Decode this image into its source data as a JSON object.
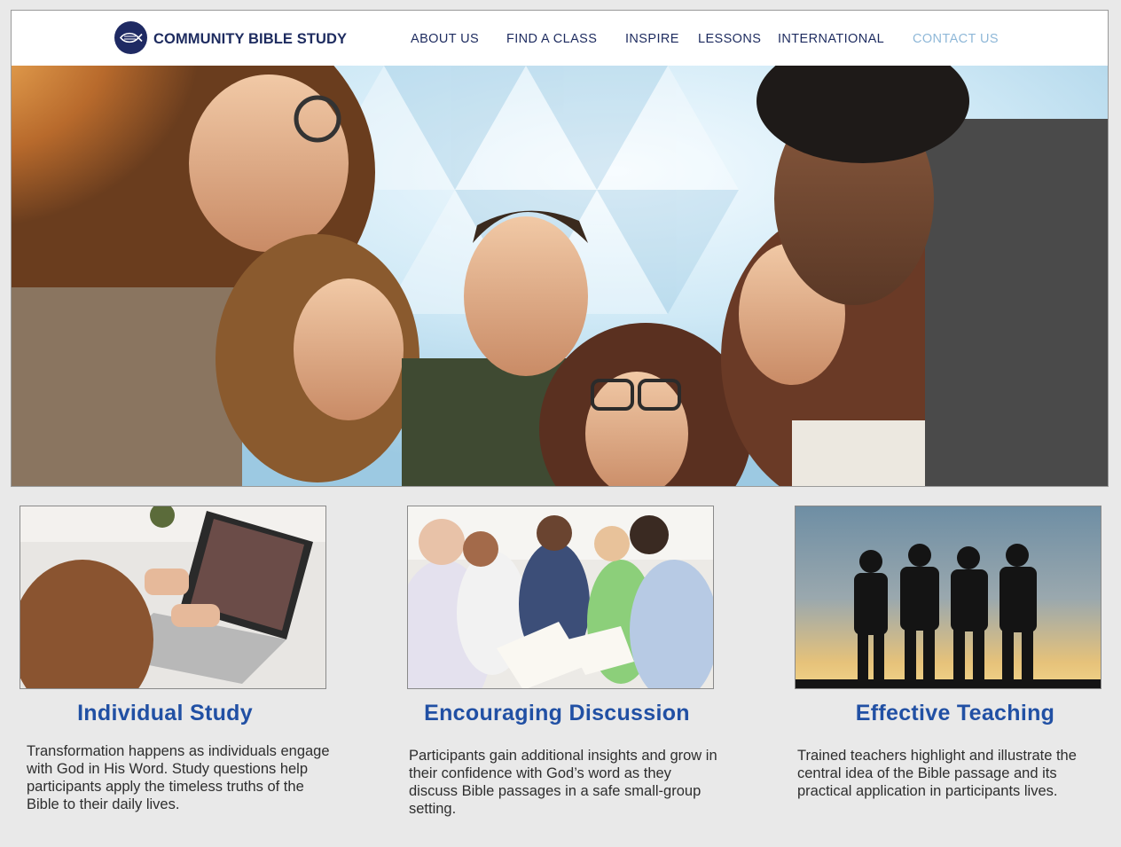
{
  "brand": {
    "name": "COMMUNITY BIBLE STUDY",
    "logo_icon": "fish-icon"
  },
  "nav": {
    "items": [
      {
        "label": "ABOUT US"
      },
      {
        "label": "FIND A CLASS"
      },
      {
        "label": "INSPIRE"
      },
      {
        "label": "LESSONS"
      },
      {
        "label": "INTERNATIONAL"
      },
      {
        "label": "CONTACT US",
        "active": true
      }
    ]
  },
  "colors": {
    "brand_navy": "#1d2b5f",
    "heading_blue": "#2150a4",
    "active_nav": "#8fb8d8",
    "page_bg": "#e9e9e9"
  },
  "features": [
    {
      "title": "Individual Study",
      "text": "Transformation happens as individuals engage with God in His Word. Study questions help participants apply the timeless truths of the Bible to their daily lives."
    },
    {
      "title": "Encouraging Discussion",
      "text": "Participants gain additional  insights and grow in their confidence with God’s word as they discuss Bible passages in a safe small-group setting."
    },
    {
      "title": "Effective Teaching",
      "text": "Trained teachers highlight and illustrate the central idea of the Bible passage and its practical application in participants lives."
    }
  ]
}
